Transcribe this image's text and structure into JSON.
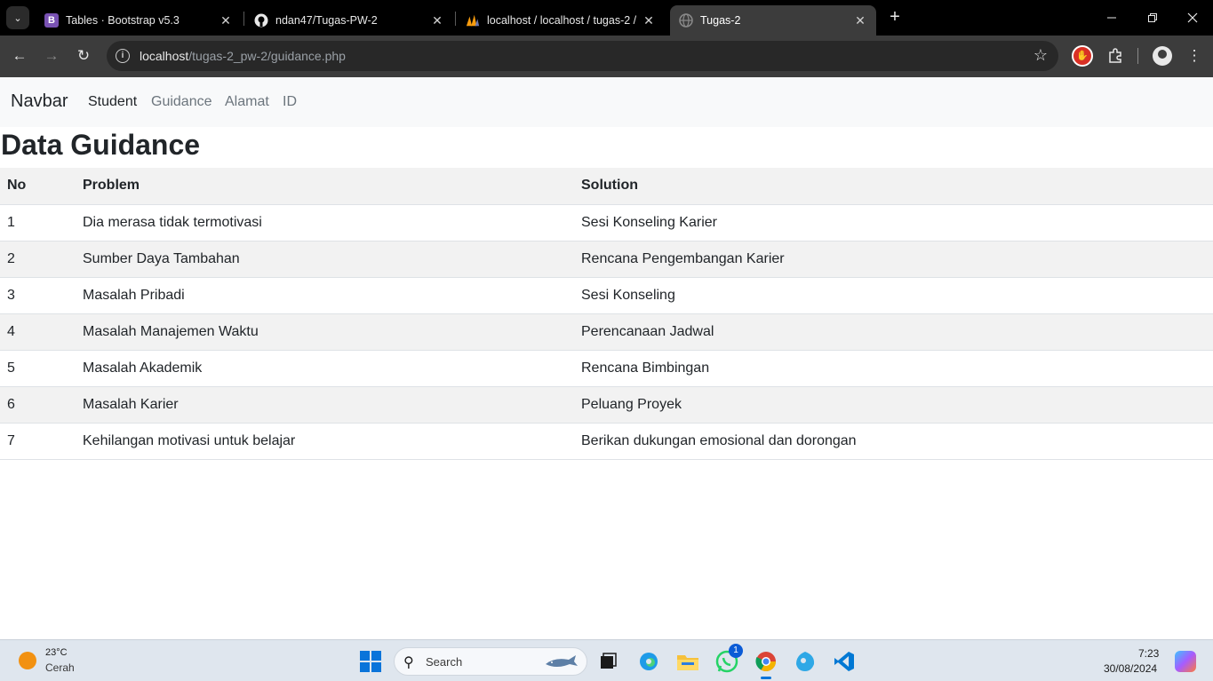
{
  "browser": {
    "tabs": [
      {
        "title": "Tables · Bootstrap v5.3",
        "favicon": "bootstrap-icon",
        "favicon_label": "B",
        "active": false
      },
      {
        "title": "ndan47/Tugas-PW-2",
        "favicon": "github-icon",
        "active": false
      },
      {
        "title": "localhost / localhost / tugas-2 /",
        "favicon": "phpmyadmin-icon",
        "active": false
      },
      {
        "title": "Tugas-2",
        "favicon": "globe-icon",
        "active": true
      }
    ],
    "url_host": "localhost",
    "url_path": "/tugas-2_pw-2/guidance.php"
  },
  "navbar": {
    "brand": "Navbar",
    "links": [
      {
        "label": "Student",
        "active": true
      },
      {
        "label": "Guidance",
        "active": false
      },
      {
        "label": "Alamat",
        "active": false
      },
      {
        "label": "ID",
        "active": false
      }
    ]
  },
  "page": {
    "title": "Data Guidance",
    "table": {
      "headers": [
        "No",
        "Problem",
        "Solution"
      ],
      "rows": [
        [
          "1",
          "Dia merasa tidak termotivasi",
          "Sesi Konseling Karier"
        ],
        [
          "2",
          "Sumber Daya Tambahan",
          "Rencana Pengembangan Karier"
        ],
        [
          "3",
          "Masalah Pribadi",
          "Sesi Konseling"
        ],
        [
          "4",
          "Masalah Manajemen Waktu",
          "Perencanaan Jadwal"
        ],
        [
          "5",
          "Masalah Akademik",
          "Rencana Bimbingan"
        ],
        [
          "6",
          "Masalah Karier",
          "Peluang Proyek"
        ],
        [
          "7",
          "Kehilangan motivasi untuk belajar",
          "Berikan dukungan emosional dan dorongan"
        ]
      ]
    }
  },
  "taskbar": {
    "weather": {
      "temp": "23°C",
      "condition": "Cerah"
    },
    "search_placeholder": "Search",
    "whatsapp_badge": "1",
    "time": "7:23",
    "date": "30/08/2024"
  },
  "colors": {
    "accent": "#0a74da",
    "table_stripe": "#f2f2f2",
    "navbar_bg": "#f8f9fa"
  }
}
